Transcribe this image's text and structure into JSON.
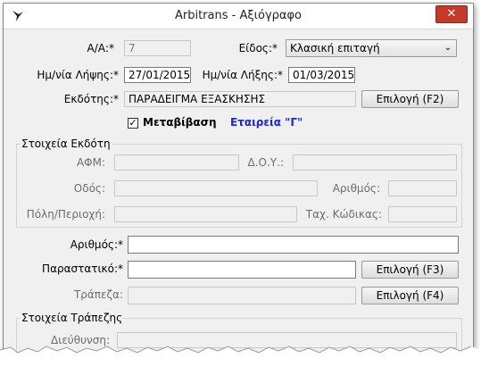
{
  "window": {
    "title": "Arbitrans - Αξιόγραφο",
    "close_label": "✕"
  },
  "form": {
    "aa_label": "Α/Α:*",
    "aa_value": "7",
    "type_label": "Είδος:*",
    "type_value": "Κλασική επιταγή",
    "receipt_date_label": "Ημ/νία Λήψης:*",
    "receipt_date_value": "27/01/2015",
    "expiry_date_label": "Ημ/νία Λήξης:*",
    "expiry_date_value": "01/03/2015",
    "issuer_label": "Εκδότης:*",
    "issuer_value": "ΠΑΡΑΔΕΙΓΜΑ ΕΞΑΣΚΗΣΗΣ",
    "issuer_button": "Επιλογή (F2)",
    "transfer_label": "Μεταβίβαση",
    "transfer_checked": true,
    "company_label": "Εταιρεία \"Γ\"",
    "issuer_group": {
      "title": "Στοιχεία Εκδότη",
      "afm_label": "ΑΦΜ:",
      "doy_label": "Δ.Ο.Υ.:",
      "street_label": "Οδός:",
      "number_label": "Αριθμός:",
      "city_label": "Πόλη/Περιοχή:",
      "zip_label": "Ταχ. Κώδικας:"
    },
    "number_label": "Αριθμός:*",
    "number_value": "",
    "document_label": "Παραστατικό:*",
    "document_value": "",
    "document_button": "Επιλογή (F3)",
    "bank_label": "Τράπεζα:",
    "bank_value": "",
    "bank_button": "Επιλογή (F4)",
    "bank_group": {
      "title": "Στοιχεία Τράπεζης",
      "address_label": "Διεύθυνση:"
    }
  },
  "colors": {
    "company": "#1d27d6",
    "close": "#c43b2c"
  }
}
